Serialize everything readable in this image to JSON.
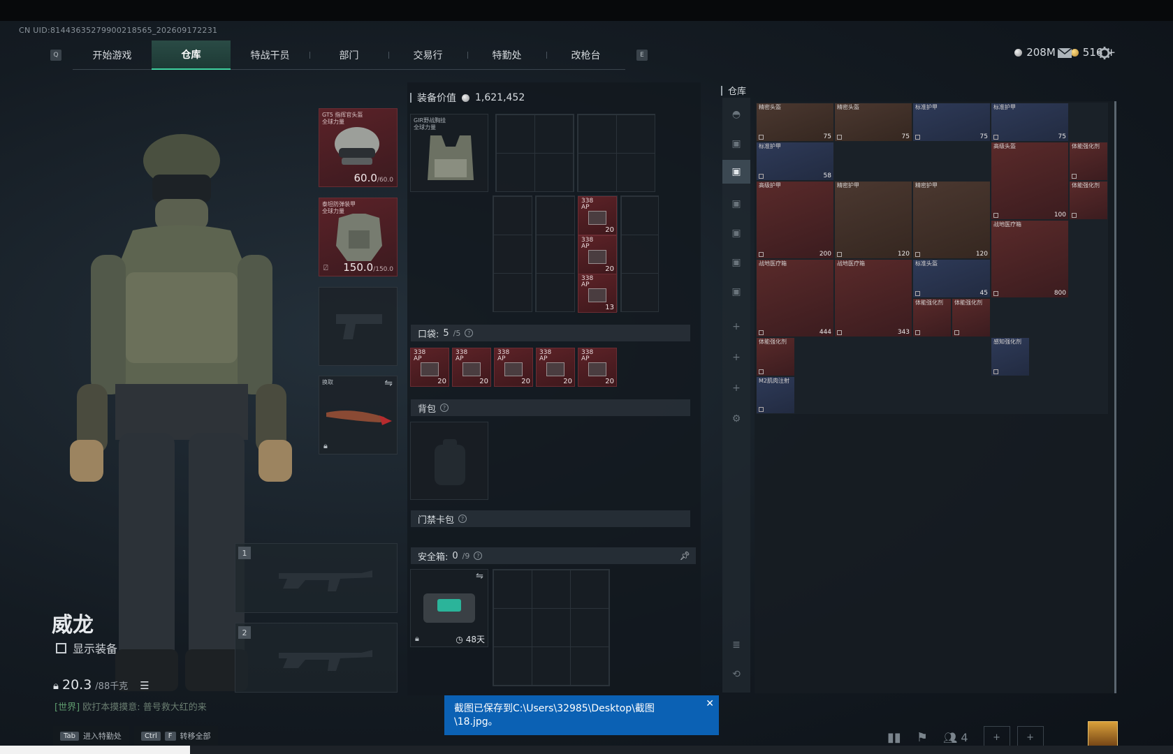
{
  "uid": "CN UID:814436352799002185​65_202609172231",
  "nav": {
    "left_key": "Q",
    "right_key": "E",
    "tabs": [
      {
        "label": "开始游戏",
        "active": false
      },
      {
        "label": "仓库",
        "active": true
      },
      {
        "label": "特战干员",
        "active": false
      },
      {
        "label": "部门",
        "active": false
      },
      {
        "label": "交易行",
        "active": false
      },
      {
        "label": "特勤处",
        "active": false
      },
      {
        "label": "改枪台",
        "active": false
      }
    ]
  },
  "currency": {
    "silver": "208M",
    "gold": "516",
    "gold_add": "+"
  },
  "operator": {
    "name": "威龙",
    "show_equip_label": "显示装备",
    "weight": "20.3",
    "weight_max": "/88千克",
    "chat_channel": "[世界]",
    "chat_text": "欧打本摸摸意: 普号救大红的来"
  },
  "hints": [
    {
      "key": "Tab",
      "label": "进入特勤处"
    },
    {
      "key": "Ctrl",
      "key2": "F",
      "label": "转移全部"
    }
  ],
  "gear": {
    "helmet": {
      "label": "GT5 指挥官头盔\n全球力量",
      "value": "60.0",
      "max": "/60.0"
    },
    "armor": {
      "label": "泰坦防弹装甲\n全球力量",
      "value": "150.0",
      "max": "/150.0"
    },
    "melee": {
      "label": "换取"
    },
    "weapon1_num": "1",
    "weapon2_num": "2"
  },
  "center": {
    "equip_value_label": "装备价值",
    "equip_value": "1,621,452",
    "rig_label": "GIR野战胸挂\n全球力量",
    "rig_ammo": [
      {
        "label": "338\nAP",
        "count": "20"
      },
      {
        "label": "338\nAP",
        "count": "20"
      },
      {
        "label": "338\nAP",
        "count": "13"
      }
    ],
    "pocket_label": "口袋:",
    "pocket_count": "5",
    "pocket_max": "/5",
    "pocket_ammo": [
      {
        "label": "338\nAP",
        "count": "20"
      },
      {
        "label": "338\nAP",
        "count": "20"
      },
      {
        "label": "338\nAP",
        "count": "20"
      },
      {
        "label": "338\nAP",
        "count": "20"
      },
      {
        "label": "338\nAP",
        "count": "20"
      }
    ],
    "backpack_label": "背包",
    "keycard_label": "门禁卡包",
    "safebox_label": "安全箱:",
    "safebox_count": "0",
    "safebox_max": "/9",
    "safebox_days": "48天"
  },
  "warehouse": {
    "title": "仓库",
    "items": [
      {
        "label": "精密头盔",
        "count": "75",
        "color": "brown"
      },
      {
        "label": "精密头盔",
        "count": "75",
        "color": "brown"
      },
      {
        "label": "标准护甲",
        "count": "75",
        "color": "blue"
      },
      {
        "label": "标准护甲",
        "count": "75",
        "color": "blue"
      },
      {
        "label": "标准护甲",
        "count": "58",
        "color": "blue"
      },
      {
        "label": "高级头盔",
        "count": "100",
        "color": "red"
      },
      {
        "label": "体能强化剂",
        "count": "",
        "color": "red"
      },
      {
        "label": "高级护甲",
        "count": "200",
        "color": "red"
      },
      {
        "label": "精密护甲",
        "count": "120",
        "color": "brown"
      },
      {
        "label": "精密护甲",
        "count": "120",
        "color": "brown"
      },
      {
        "label": "战地医疗箱",
        "count": "800",
        "color": "red"
      },
      {
        "label": "体能强化剂",
        "count": "",
        "color": "red"
      },
      {
        "label": "战地医疗箱",
        "count": "444",
        "color": "red"
      },
      {
        "label": "战地医疗箱",
        "count": "343",
        "color": "red"
      },
      {
        "label": "标准头盔",
        "count": "45",
        "color": "blue"
      },
      {
        "label": "体能强化剂",
        "count": "",
        "color": "red"
      },
      {
        "label": "体能强化剂",
        "count": "",
        "color": "red"
      },
      {
        "label": "体能强化剂",
        "count": "",
        "color": "red"
      },
      {
        "label": "感知强化剂",
        "count": "",
        "color": "blue"
      },
      {
        "label": "M2肌肉注射",
        "count": "",
        "color": "blue"
      }
    ]
  },
  "toast": {
    "line1": "截图已保存到C:\\Users\\32985\\Desktop\\截图",
    "line2": "\\18.jpg。"
  },
  "bottom": {
    "team_count": "4"
  }
}
